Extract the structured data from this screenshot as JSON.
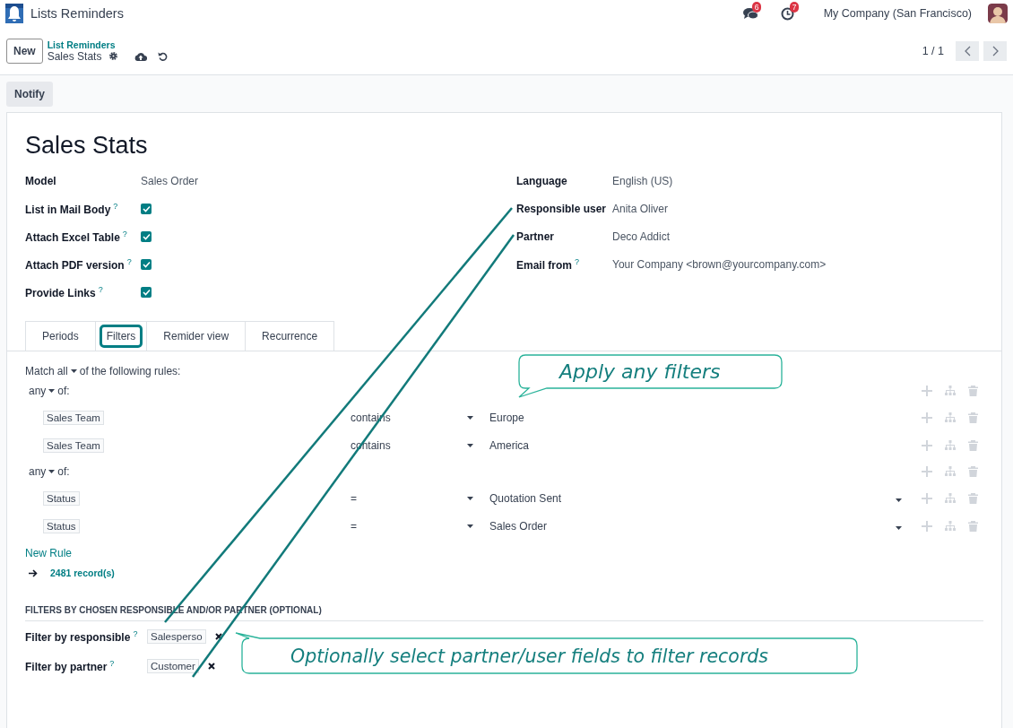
{
  "app": {
    "title": "Lists Reminders"
  },
  "systray": {
    "messages_count": "6",
    "activities_count": "7",
    "company": "My Company (San Francisco)"
  },
  "breadcrumb": {
    "parent": "List Reminders",
    "current": "Sales Stats"
  },
  "new_button": "New",
  "pager": "1 / 1",
  "actions": [
    "Notify"
  ],
  "record": {
    "name": "Sales Stats",
    "left_fields": [
      {
        "label": "Model",
        "kind": "text",
        "value": "Sales Order"
      },
      {
        "label": "List in Mail Body",
        "help": "?",
        "kind": "checkbox",
        "checked": true
      },
      {
        "label": "Attach Excel Table",
        "help": "?",
        "kind": "checkbox",
        "checked": true
      },
      {
        "label": "Attach PDF version",
        "help": "?",
        "kind": "checkbox",
        "checked": true
      },
      {
        "label": "Provide Links",
        "help": "?",
        "kind": "checkbox",
        "checked": true
      }
    ],
    "right_fields": [
      {
        "label": "Language",
        "kind": "text",
        "value": "English (US)"
      },
      {
        "label": "Responsible user",
        "kind": "text",
        "value": "Anita Oliver"
      },
      {
        "label": "Partner",
        "kind": "text",
        "value": "Deco Addict"
      },
      {
        "label": "Email from",
        "help": "?",
        "kind": "text",
        "value": "Your Company <brown@yourcompany.com>"
      }
    ]
  },
  "tabs": [
    {
      "label": "Periods",
      "selected": false
    },
    {
      "label": "Filters",
      "selected": true
    },
    {
      "label": "Remider view",
      "selected": false
    },
    {
      "label": "Recurrence",
      "selected": false
    }
  ],
  "domain": {
    "match_prefix": "Match",
    "match_mode": "all",
    "match_suffix": "of the following rules:",
    "groups": [
      {
        "mode": "any",
        "suffix": "of:",
        "rules": [
          {
            "field": "Sales Team",
            "operator": "contains",
            "value": "Europe",
            "value_dropdown": false
          },
          {
            "field": "Sales Team",
            "operator": "contains",
            "value": "America",
            "value_dropdown": false
          }
        ]
      },
      {
        "mode": "any",
        "suffix": "of:",
        "rules": [
          {
            "field": "Status",
            "operator": "=",
            "value": "Quotation Sent",
            "value_dropdown": true
          },
          {
            "field": "Status",
            "operator": "=",
            "value": "Sales Order",
            "value_dropdown": true
          }
        ]
      }
    ],
    "new_rule": "New Rule",
    "records": "2481 record(s)"
  },
  "optional_section": {
    "title": "FILTERS BY CHOSEN RESPONSIBLE AND/OR PARTNER (OPTIONAL)",
    "fields": [
      {
        "label": "Filter by responsible",
        "help": "?",
        "tag": "Salesperso"
      },
      {
        "label": "Filter by partner",
        "help": "?",
        "tag": "Customer"
      }
    ]
  },
  "callouts": [
    {
      "text": "Apply any filters",
      "kind": "below"
    },
    {
      "text": "Optionally select partner/user fields to filter records",
      "kind": "above"
    }
  ]
}
